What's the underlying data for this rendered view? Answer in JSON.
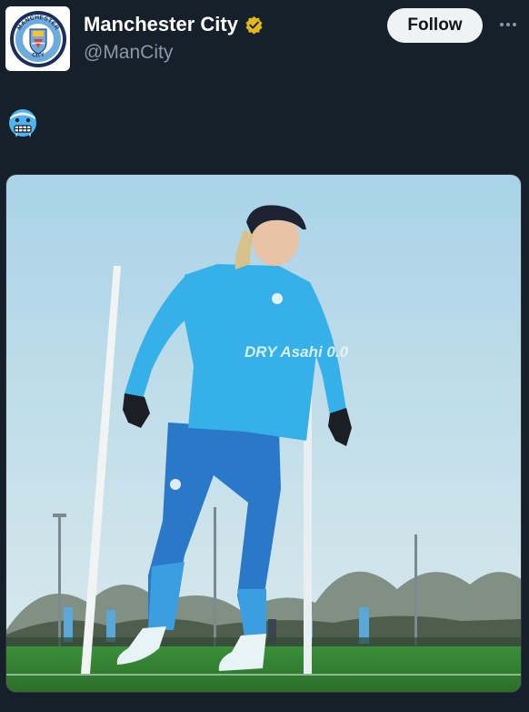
{
  "account": {
    "display_name": "Manchester City",
    "handle": "@ManCity",
    "verified_icon": "verified-badge-gold",
    "avatar_icon": "manchester-city-crest"
  },
  "crest": {
    "top_text": "MANCHESTER",
    "bottom_text": "CITY"
  },
  "actions": {
    "follow_label": "Follow",
    "more_icon": "more-horizontal-icon"
  },
  "tweet": {
    "text_emoji_icon": "cold-face-emoji"
  },
  "media": {
    "shirt_sponsor": "DRY Asahi 0.0"
  },
  "colors": {
    "background": "#15202b",
    "secondary_text": "#8b98a5",
    "follow_bg": "#eff3f4",
    "verified_gold": "#e2b719",
    "sky_blue": "#2aa7e0"
  }
}
